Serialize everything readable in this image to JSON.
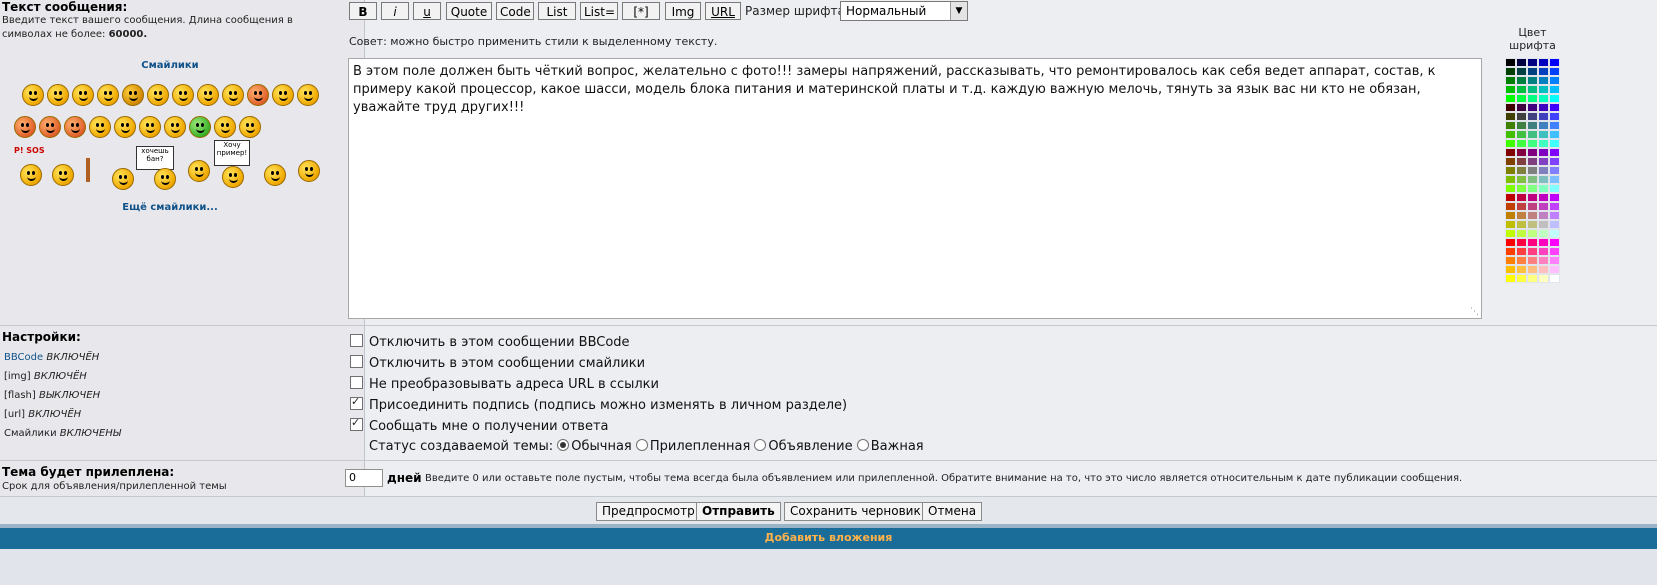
{
  "message_section": {
    "title": "Текст сообщения:",
    "hint_prefix": "Введите текст вашего сообщения. Длина сообщения в символах не более: ",
    "max_length": "60000.",
    "smilies_title": "Смайлики",
    "more_smilies": "Ещё смайлики...",
    "smiley_signs": [
      "P! SOS",
      "хочешь бан?",
      "Хочу пример!"
    ]
  },
  "toolbar": {
    "buttons": [
      "B",
      "i",
      "u",
      "Quote",
      "Code",
      "List",
      "List=",
      "[*]",
      "Img",
      "URL"
    ],
    "font_size_label": "Размер шрифта:",
    "font_size_value": "Нормальный",
    "tip": "Совет: можно быстро применить стили к выделенному тексту."
  },
  "font_color": {
    "label_line1": "Цвет",
    "label_line2": "шрифта"
  },
  "editor": {
    "text": "В этом поле должен быть чёткий вопрос, желательно с фото!!! замеры напряжений, рассказывать, что ремонтировалось как себя ведет аппарат, состав, к примеру какой процессор, какое шасси, модель блока питания и материнской платы и т.д. каждую важную мелочь, тянуть за язык вас ни кто не обязан, уважайте труд других!!!"
  },
  "settings": {
    "title": "Настройки:",
    "status_lines": [
      {
        "name": "BBCode",
        "value": "ВКЛЮЧЁН"
      },
      {
        "name": "[img]",
        "value": "ВКЛЮЧЁН"
      },
      {
        "name": "[flash]",
        "value": "ВЫКЛЮЧЕН"
      },
      {
        "name": "[url]",
        "value": "ВКЛЮЧЁН"
      },
      {
        "name": "Смайлики",
        "value": "ВКЛЮЧЕНЫ"
      }
    ],
    "options": [
      {
        "label": "Отключить в этом сообщении BBCode",
        "checked": false
      },
      {
        "label": "Отключить в этом сообщении смайлики",
        "checked": false
      },
      {
        "label": "Не преобразовывать адреса URL в ссылки",
        "checked": false
      },
      {
        "label": "Присоединить подпись (подпись можно изменять в личном разделе)",
        "checked": true
      },
      {
        "label": "Сообщать мне о получении ответа",
        "checked": true
      }
    ],
    "topic_status_label": "Статус создаваемой темы:",
    "topic_status_options": [
      {
        "label": "Обычная",
        "selected": true
      },
      {
        "label": "Прилепленная",
        "selected": false
      },
      {
        "label": "Объявление",
        "selected": false
      },
      {
        "label": "Важная",
        "selected": false
      }
    ]
  },
  "sticky": {
    "title": "Тема будет прилеплена:",
    "subtitle": "Срок для объявления/прилепленной темы",
    "days_value": "0",
    "days_label": "дней",
    "hint": "Введите 0 или оставьте поле пустым, чтобы тема всегда была объявлением или прилепленной. Обратите внимание на то, что это число является относительным к дате публикации сообщения."
  },
  "actions": {
    "preview": "Предпросмотр",
    "submit": "Отправить",
    "save_draft": "Сохранить черновик",
    "cancel": "Отмена"
  },
  "attachments_bar": {
    "label": "Добавить вложения",
    "color": "#1a6d98",
    "text_color": "#ffb14a"
  }
}
